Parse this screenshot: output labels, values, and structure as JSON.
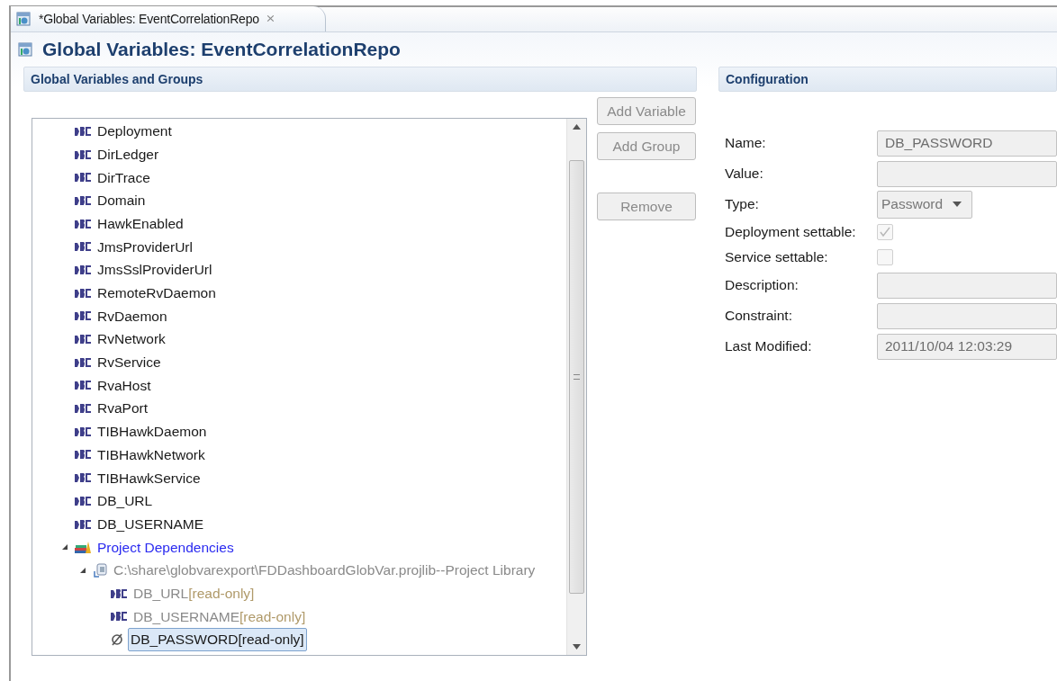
{
  "tab": {
    "title": "*Global Variables: EventCorrelationRepo",
    "close": "⨯",
    "dirty": true
  },
  "page_title": "Global Variables: EventCorrelationRepo",
  "left_section": {
    "title": "Global Variables and Groups"
  },
  "tree": [
    {
      "kind": "string",
      "label": "Deployment",
      "selected": false
    },
    {
      "kind": "string",
      "label": "DirLedger",
      "selected": false
    },
    {
      "kind": "string",
      "label": "DirTrace",
      "selected": false
    },
    {
      "kind": "string",
      "label": "Domain",
      "selected": false
    },
    {
      "kind": "string",
      "label": "HawkEnabled",
      "selected": false
    },
    {
      "kind": "string",
      "label": "JmsProviderUrl",
      "selected": false
    },
    {
      "kind": "string",
      "label": "JmsSslProviderUrl",
      "selected": false
    },
    {
      "kind": "string",
      "label": "RemoteRvDaemon",
      "selected": false
    },
    {
      "kind": "string",
      "label": "RvDaemon",
      "selected": false
    },
    {
      "kind": "string",
      "label": "RvNetwork",
      "selected": false
    },
    {
      "kind": "string",
      "label": "RvService",
      "selected": false
    },
    {
      "kind": "string",
      "label": "RvaHost",
      "selected": false
    },
    {
      "kind": "string",
      "label": "RvaPort",
      "selected": false
    },
    {
      "kind": "string",
      "label": "TIBHawkDaemon",
      "selected": false
    },
    {
      "kind": "string",
      "label": "TIBHawkNetwork",
      "selected": false
    },
    {
      "kind": "string",
      "label": "TIBHawkService",
      "selected": false
    },
    {
      "kind": "string",
      "label": "DB_URL",
      "selected": false
    },
    {
      "kind": "string",
      "label": "DB_USERNAME",
      "selected": false
    },
    {
      "kind": "dependencies",
      "label": "Project Dependencies",
      "selected": false,
      "expanded": true,
      "children": [
        {
          "kind": "library",
          "label": "C:\\share\\globvarexport\\FDDashboardGlobVar.projlib--Project Library",
          "selected": false,
          "expanded": true,
          "children": [
            {
              "kind": "string",
              "label": "DB_URL",
              "suffix": "[read-only]",
              "read_only": true,
              "selected": false
            },
            {
              "kind": "string",
              "label": "DB_USERNAME",
              "suffix": "[read-only]",
              "read_only": true,
              "selected": false
            },
            {
              "kind": "password",
              "label": "DB_PASSWORD",
              "suffix": "[read-only]",
              "read_only": true,
              "selected": true
            }
          ]
        }
      ]
    }
  ],
  "buttons": [
    {
      "label": "Add Variable",
      "disabled": true
    },
    {
      "label": "Add Group",
      "disabled": true
    },
    {
      "label": "Remove",
      "disabled": true
    }
  ],
  "right_section": {
    "title": "Configuration"
  },
  "fields": [
    {
      "kind": "text",
      "label": "Name:",
      "value": "DB_PASSWORD",
      "disabled": true
    },
    {
      "kind": "text",
      "label": "Value:",
      "disabled": true
    },
    {
      "kind": "combo",
      "label": "Type:",
      "value": "Password",
      "disabled": true
    },
    {
      "kind": "checkbox",
      "label": "Deployment settable:",
      "checked": true,
      "disabled": true
    },
    {
      "kind": "checkbox",
      "label": "Service settable:",
      "checked": false,
      "disabled": true
    },
    {
      "kind": "text",
      "label": "Description:",
      "disabled": true
    },
    {
      "kind": "text",
      "label": "Constraint:",
      "disabled": true
    },
    {
      "kind": "text",
      "label": "Last Modified:",
      "value": "2011/10/04 12:03:29",
      "disabled": true
    }
  ]
}
